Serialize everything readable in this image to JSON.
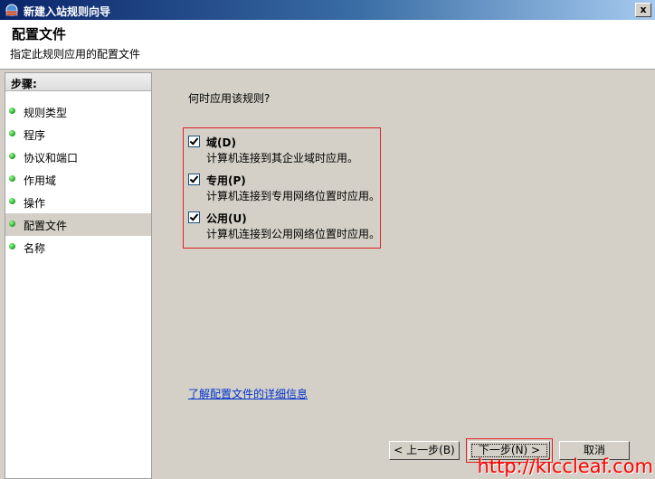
{
  "window": {
    "title": "新建入站规则向导",
    "close_symbol": "x"
  },
  "header": {
    "title": "配置文件",
    "subtitle": "指定此规则应用的配置文件"
  },
  "sidebar": {
    "heading": "步骤:",
    "items": [
      {
        "label": "规则类型"
      },
      {
        "label": "程序"
      },
      {
        "label": "协议和端口"
      },
      {
        "label": "作用域"
      },
      {
        "label": "操作"
      },
      {
        "label": "配置文件",
        "selected": true
      },
      {
        "label": "名称"
      }
    ]
  },
  "main": {
    "question": "何时应用该规则?",
    "options": [
      {
        "label": "域(D)",
        "description": "计算机连接到其企业域时应用。",
        "checked": true
      },
      {
        "label": "专用(P)",
        "description": "计算机连接到专用网络位置时应用。",
        "checked": true
      },
      {
        "label": "公用(U)",
        "description": "计算机连接到公用网络位置时应用。",
        "checked": true
      }
    ],
    "learn_more_link": "了解配置文件的详细信息"
  },
  "buttons": {
    "back": "< 上一步(B)",
    "next": "下一步(N) >",
    "cancel": "取消"
  },
  "watermark": "http://kiccleaf.com",
  "colors": {
    "highlight_box": "#e02020",
    "link": "#0033cc",
    "watermark": "#ff0000",
    "title_bar": "#0a246a"
  }
}
